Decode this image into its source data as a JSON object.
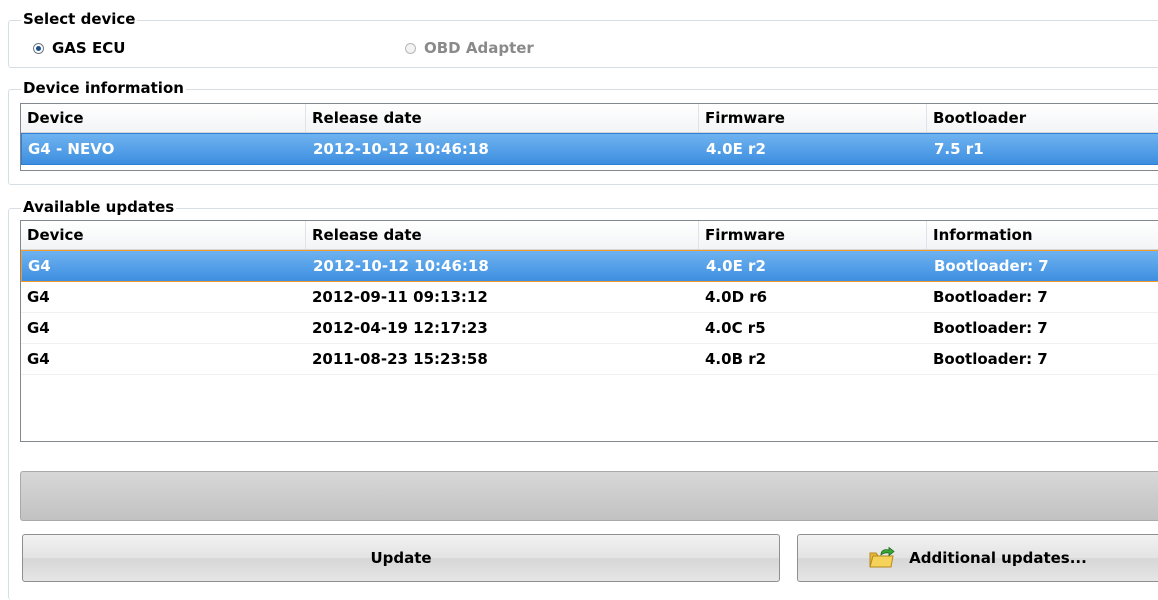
{
  "select_device": {
    "legend": "Select device",
    "options": [
      {
        "label": "GAS ECU",
        "selected": true,
        "enabled": true
      },
      {
        "label": "OBD Adapter",
        "selected": false,
        "enabled": false
      }
    ]
  },
  "device_information": {
    "legend": "Device information",
    "columns": [
      "Device",
      "Release date",
      "Firmware",
      "Bootloader"
    ],
    "rows": [
      [
        "G4 - NEVO",
        "2012-10-12 10:46:18",
        "4.0E r2",
        "7.5 r1"
      ]
    ]
  },
  "available_updates": {
    "legend": "Available updates",
    "columns": [
      "Device",
      "Release date",
      "Firmware",
      "Information"
    ],
    "rows": [
      [
        "G4",
        "2012-10-12 10:46:18",
        "4.0E r2",
        "Bootloader: 7"
      ],
      [
        "G4",
        "2012-09-11 09:13:12",
        "4.0D r6",
        "Bootloader: 7"
      ],
      [
        "G4",
        "2012-04-19 12:17:23",
        "4.0C r5",
        "Bootloader: 7"
      ],
      [
        "G4",
        "2011-08-23 15:23:58",
        "4.0B r2",
        "Bootloader: 7"
      ]
    ]
  },
  "buttons": {
    "update_label": "Update",
    "additional_label": "Additional updates...",
    "additional_icon": "folder-arrow-icon"
  },
  "colors": {
    "selection": "#3d8ee0",
    "focus_border": "#f39a2a"
  }
}
